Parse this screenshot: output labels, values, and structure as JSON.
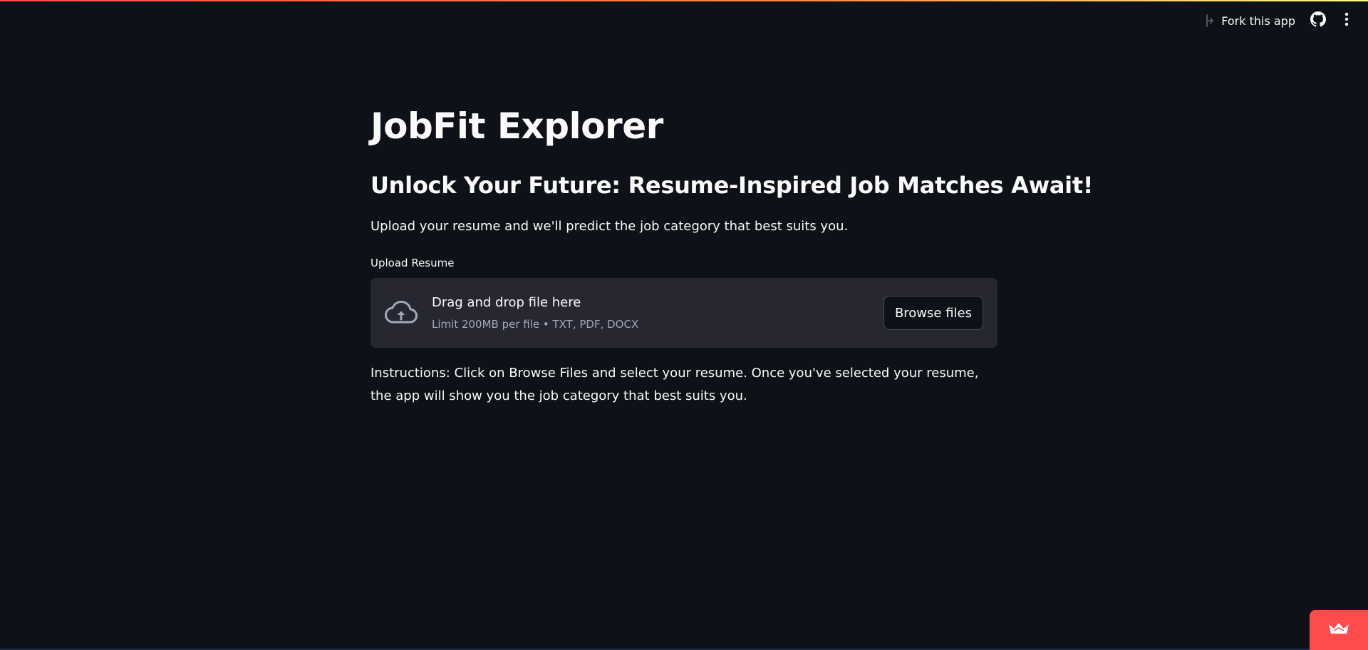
{
  "app": {
    "title": "JobFit Explorer",
    "subtitle": "Unlock Your Future: Resume-Inspired Job Matches Await!",
    "intro": "Upload your resume and we'll predict the job category that best suits you."
  },
  "toolbar": {
    "fork_label": "Fork this app",
    "icons": [
      "fork-icon",
      "github-icon",
      "kebab-menu-icon"
    ]
  },
  "uploader": {
    "label": "Upload Resume",
    "drop_text": "Drag and drop file here",
    "limit_text": "Limit 200MB per file • TXT, PDF, DOCX",
    "browse_label": "Browse files",
    "icon": "cloud-upload-icon"
  },
  "instructions": "Instructions: Click on Browse Files and select your resume. Once you've selected your resume, the app will show you the job category that best suits you.",
  "badge": {
    "icon": "crown-icon"
  },
  "colors": {
    "background": "#0e1117",
    "dropzone": "#262730",
    "accent": "#ff4b4b",
    "text": "#fafafa",
    "muted": "#a3a8b8"
  }
}
